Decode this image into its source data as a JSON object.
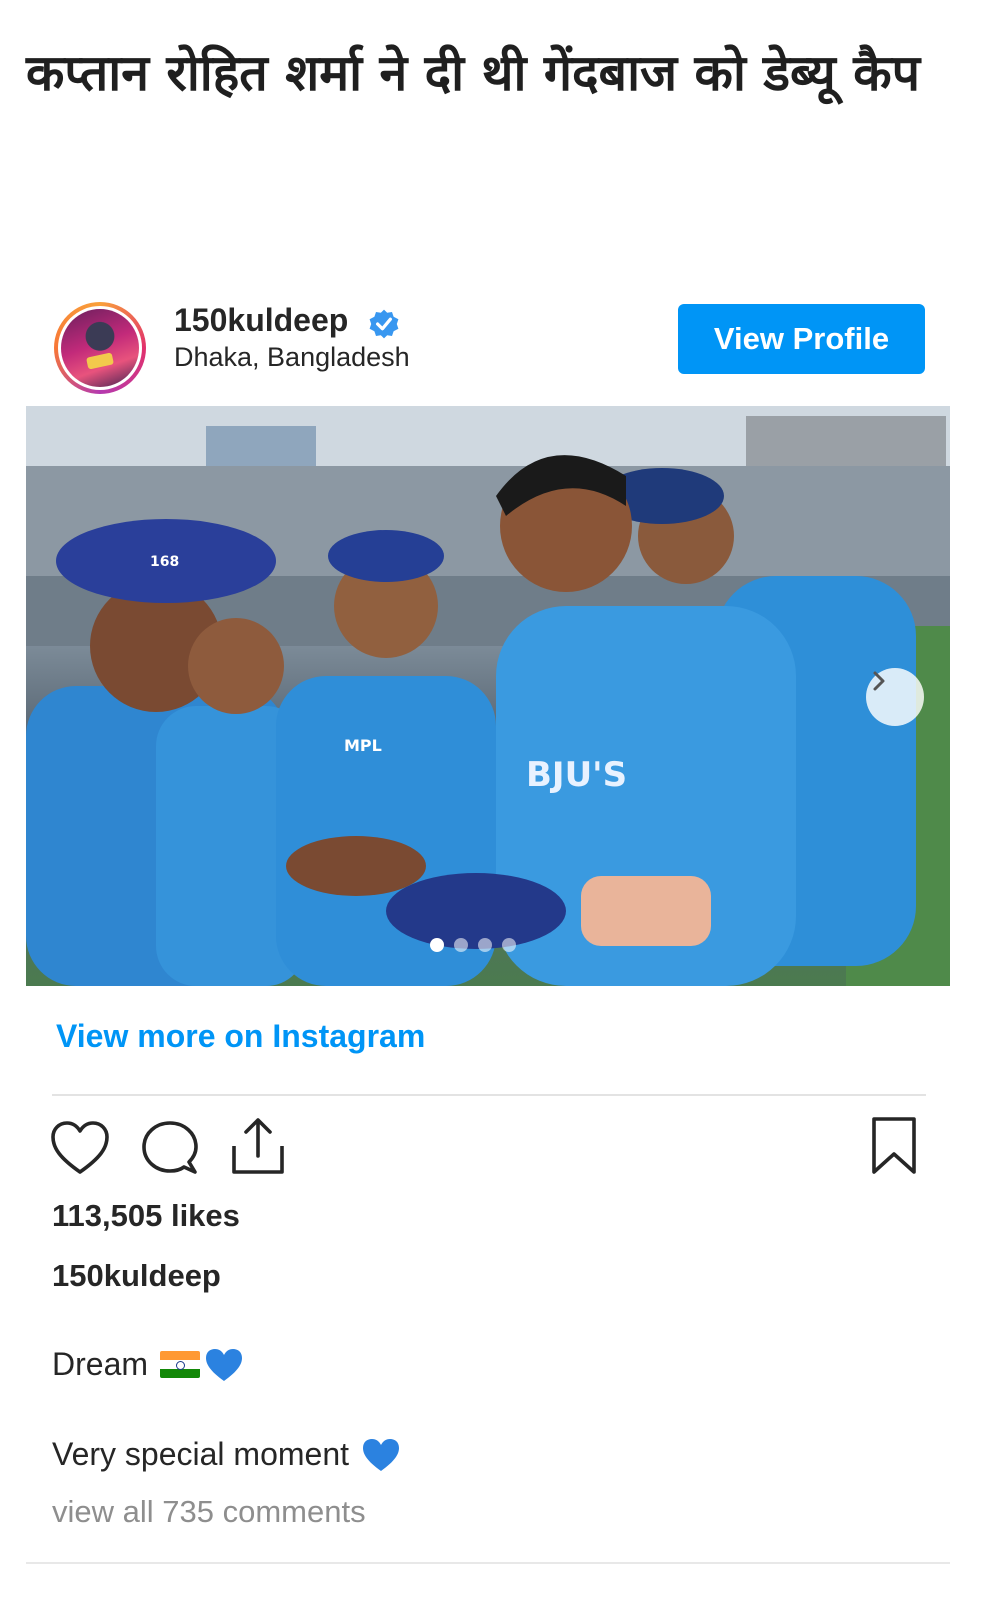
{
  "article": {
    "headline": "कप्तान रोहित शर्मा ने दी थी गेंदबाज को डेब्यू कैप"
  },
  "post": {
    "username": "150kuldeep",
    "location": "Dhaka, Bangladesh",
    "view_profile_label": "View Profile",
    "view_more_label": "View more on Instagram",
    "likes_text": "113,505 likes",
    "caption_username": "150kuldeep",
    "caption_line_1": "Dream",
    "caption_line_2": "Very special moment",
    "view_comments_text": "view all 735 comments",
    "carousel": {
      "total": 4,
      "active_index": 0
    },
    "photo_texts": {
      "cap_number": "168",
      "sponsor": "BJU'S",
      "kit": "MPL"
    }
  },
  "icons": {
    "like": "heart-outline-icon",
    "comment": "comment-bubble-icon",
    "share": "share-upload-icon",
    "save": "bookmark-icon",
    "verified": "verified-badge-icon",
    "next": "chevron-right-icon"
  },
  "colors": {
    "accent": "#0095f6",
    "text": "#262626",
    "muted": "#8e8e8e",
    "jersey": "#2e8fd8",
    "heart_emoji": "#2b82e0"
  }
}
